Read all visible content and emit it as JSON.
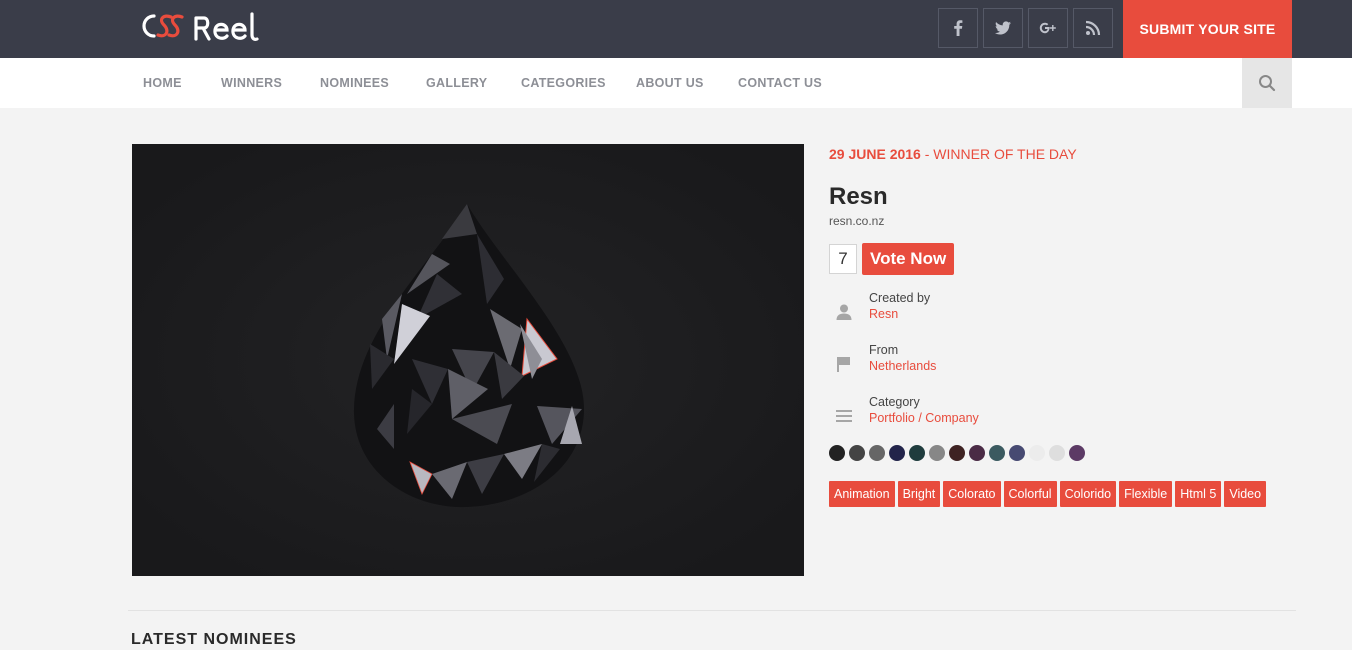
{
  "header": {
    "logo_text": "CSS REEL",
    "submit_label": "SUBMIT YOUR SITE",
    "social": [
      {
        "icon": "facebook-icon",
        "glyph": "f"
      },
      {
        "icon": "twitter-icon",
        "glyph": ""
      },
      {
        "icon": "google-plus-icon",
        "glyph": "g+"
      },
      {
        "icon": "rss-icon",
        "glyph": ""
      }
    ]
  },
  "nav": {
    "items": [
      "HOME",
      "WINNERS",
      "NOMINEES",
      "GALLERY",
      "CATEGORIES",
      "ABOUT US",
      "CONTACT US"
    ]
  },
  "feature": {
    "date": "29 JUNE 2016",
    "award": " - WINNER OF THE DAY",
    "title": "Resn",
    "url": "resn.co.nz",
    "votes": "7",
    "vote_label": "Vote Now",
    "created_by_label": "Created by",
    "created_by_value": "Resn",
    "from_label": "From",
    "from_value": "Netherlands",
    "category_label": "Category",
    "category_value": "Portfolio / Company",
    "colors": [
      "#222222",
      "#444444",
      "#666666",
      "#22244a",
      "#1f3c3d",
      "#878787",
      "#3e2222",
      "#4a2b45",
      "#3b5a60",
      "#474a72",
      "#ececec",
      "#dedede",
      "#5c3a65"
    ],
    "tags": [
      "Animation",
      "Bright",
      "Colorato",
      "Colorful",
      "Colorido",
      "Flexible",
      "Html 5",
      "Video"
    ]
  },
  "section": {
    "heading": "LATEST NOMINEES"
  },
  "theme": {
    "accent": "#e84c3d",
    "topbar": "#3a3d49"
  }
}
